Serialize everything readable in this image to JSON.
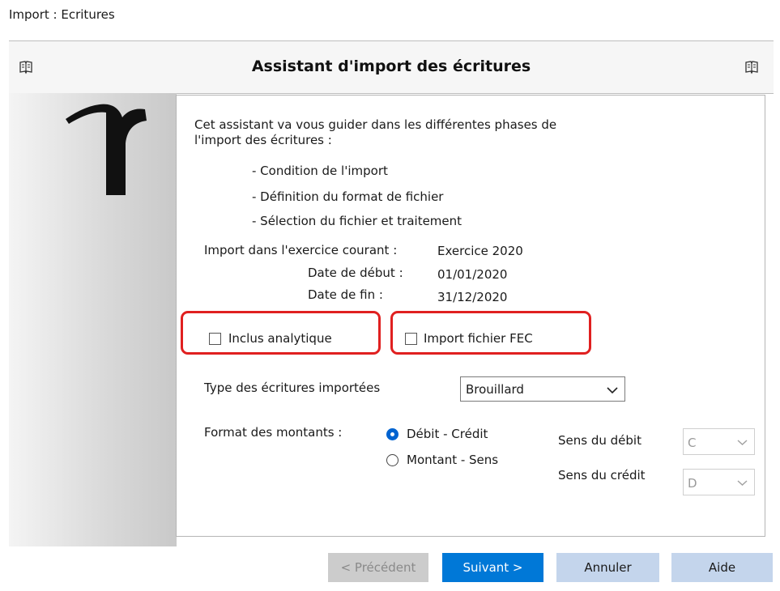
{
  "window": {
    "title": "Import : Ecritures"
  },
  "header": {
    "title": "Assistant d'import des écritures",
    "icon_left": "book-icon",
    "icon_right": "book-icon"
  },
  "sidebar": {
    "logo_icon": "logo-r-icon"
  },
  "intro": {
    "line1": "Cet assistant va vous guider dans les différentes phases de",
    "line2": "l'import des écritures :",
    "phases": [
      "- Condition de l'import",
      "- Définition du format de fichier",
      "- Sélection du fichier et traitement"
    ]
  },
  "exercise": {
    "current_label": "Import dans l'exercice courant :",
    "current_value": "Exercice 2020",
    "start_label": "Date de début :",
    "start_value": "01/01/2020",
    "end_label": "Date de fin :",
    "end_value": "31/12/2020"
  },
  "options": {
    "analytique_label": "Inclus analytique",
    "analytique_checked": false,
    "fec_label": "Import fichier FEC",
    "fec_checked": false,
    "highlight_color": "#e02020"
  },
  "entry_type": {
    "label": "Type des écritures importées",
    "selected": "Brouillard"
  },
  "amount_format": {
    "label": "Format des montants :",
    "option_debit_credit": "Débit - Crédit",
    "option_montant_sens": "Montant - Sens",
    "selected": "Débit - Crédit",
    "debit_sense_label": "Sens du débit",
    "debit_sense_value": "C",
    "credit_sense_label": "Sens du crédit",
    "credit_sense_value": "D"
  },
  "buttons": {
    "previous": "< Précédent",
    "next": "Suivant >",
    "cancel": "Annuler",
    "help": "Aide"
  },
  "colors": {
    "primary": "#0078d7",
    "secondary_button": "#c4d5ec",
    "disabled_button": "#cccccc"
  }
}
